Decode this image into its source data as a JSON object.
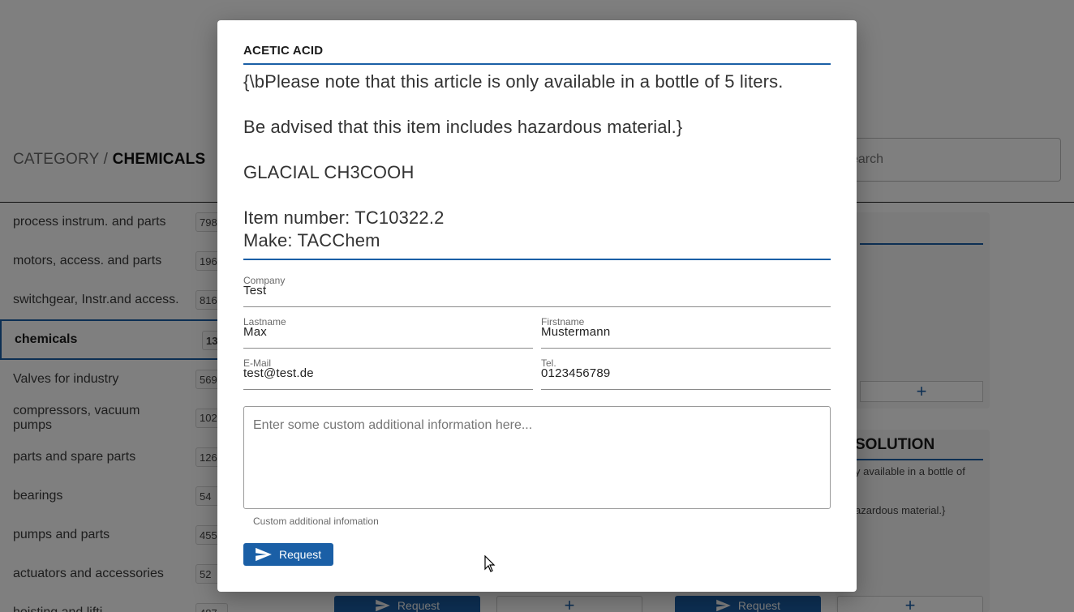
{
  "background": {
    "breadcrumb": {
      "root": "CATEGORY /",
      "current": "CHEMICALS"
    },
    "search": {
      "placeholder": "earch"
    },
    "categories": [
      {
        "label": "process instrum. and parts",
        "count": "798"
      },
      {
        "label": "motors, access. and parts",
        "count": "196"
      },
      {
        "label": "switchgear, Instr.and access.",
        "count": "816"
      },
      {
        "label": "chemicals",
        "count": "13"
      },
      {
        "label": "Valves for industry",
        "count": "569"
      },
      {
        "label": "compressors, vacuum pumps",
        "count": "102"
      },
      {
        "label": "parts and spare parts",
        "count": "126"
      },
      {
        "label": "bearings",
        "count": "54"
      },
      {
        "label": "pumps and parts",
        "count": "455"
      },
      {
        "label": "actuators and accessories",
        "count": "52"
      },
      {
        "label": "hoisting and lifti",
        "count": "487"
      }
    ],
    "card2": {
      "title_fragment": "SOLUTION",
      "text1": "y available in a bottle of",
      "text2": "azardous material.}"
    },
    "request_label": "Request",
    "plus_label": "+"
  },
  "modal": {
    "title": "ACETIC ACID",
    "description": {
      "line1": "{\\bPlease note that this article is only available in a bottle of 5 liters.",
      "line2": "Be advised that this item includes hazardous material.}",
      "line3": "GLACIAL CH3COOH",
      "line4": "Item number: TC10322.2",
      "line5": "Make: TACChem"
    },
    "fields": {
      "company": {
        "label": "Company",
        "value": "Test"
      },
      "lastname": {
        "label": "Lastname",
        "value": "Max"
      },
      "firstname": {
        "label": "Firstname",
        "value": "Mustermann"
      },
      "email": {
        "label": "E-Mail",
        "value": "test@test.de"
      },
      "tel": {
        "label": "Tel.",
        "value": "0123456789"
      }
    },
    "custom_info": {
      "placeholder": "Enter some custom additional information here...",
      "hint": "Custom additional infomation"
    },
    "request_button": "Request"
  },
  "colors": {
    "accent": "#1a5fa6",
    "overlay": "rgba(0,0,0,0.5)"
  }
}
